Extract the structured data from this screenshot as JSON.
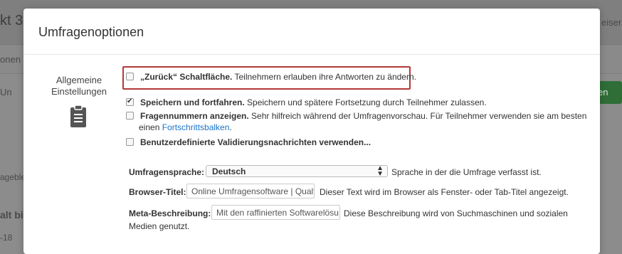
{
  "background": {
    "title_fragment": "kt 3",
    "top_right_fragment": "eiser",
    "row1_fragment": "onen",
    "row2_fragment": "Un",
    "green_button_fragment": "en",
    "row3_fragment": "ageble",
    "row4_fragment": "alt bis",
    "row5_fragment": "-18"
  },
  "modal": {
    "title": "Umfragenoptionen",
    "section_label": "Allgemeine Einstellungen",
    "section_icon": "clipboard-icon",
    "options": [
      {
        "bold": "„Zurück“ Schaltfläche.",
        "text": " Teilnehmern erlauben ihre Antworten zu ändern.",
        "checked": false
      },
      {
        "bold": "Speichern und fortfahren.",
        "text": " Speichern und spätere Fortsetzung durch Teilnehmer zulassen.",
        "checked": true
      },
      {
        "bold": "Fragennummern anzeigen.",
        "text": " Sehr hilfreich während der Umfragenvorschau. Für Teilnehmer verwenden sie am besten",
        "text2_prefix": "einen ",
        "link": "Fortschrittsbalken",
        "text2_suffix": ".",
        "checked": false
      },
      {
        "bold": "Benutzerdefinierte Validierungsnachrichten verwenden...",
        "text": "",
        "checked": false
      }
    ],
    "language": {
      "label": "Umfragensprache:",
      "value": "Deutsch",
      "help": "Sprache in der die Umfrage verfasst ist."
    },
    "browser_title": {
      "label": "Browser-Titel:",
      "value": "Online Umfragensoftware | Qualt",
      "help": "Dieser Text wird im Browser als Fenster- oder Tab-Titel angezeigt."
    },
    "meta_description": {
      "label": "Meta-Beschreibung:",
      "value": "Mit den raffinierten Softwarelösu",
      "help_line1": "Diese Beschreibung wird von Suchmaschinen und sozialen",
      "help_line2": "Medien genutzt."
    },
    "highlight_color": "#b33a3a",
    "link_color": "#1a73c7"
  }
}
